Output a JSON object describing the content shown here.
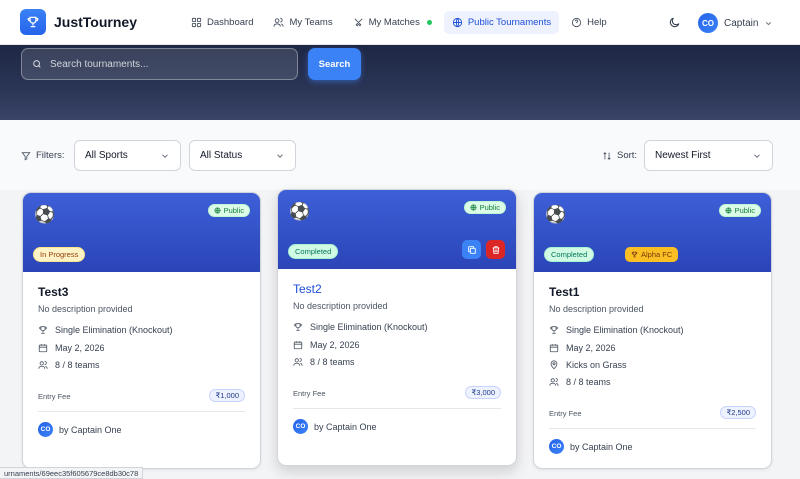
{
  "app": {
    "brand": "JustTourney"
  },
  "nav": {
    "items": [
      {
        "label": "Dashboard",
        "icon": "grid-icon"
      },
      {
        "label": "My Teams",
        "icon": "users-icon"
      },
      {
        "label": "My Matches",
        "icon": "swords-icon"
      },
      {
        "label": "Public Tournaments",
        "icon": "globe-icon"
      },
      {
        "label": "Help",
        "icon": "help-circle-icon"
      }
    ],
    "active": "Public Tournaments"
  },
  "user": {
    "initials": "CO",
    "name": "Captain"
  },
  "search": {
    "placeholder": "Search tournaments...",
    "value": "",
    "button_label": "Search"
  },
  "filters": {
    "label": "Filters:",
    "sport": "All Sports",
    "status": "All Status",
    "sort_label": "Sort:",
    "sort": "Newest First"
  },
  "cards": [
    {
      "title": "Test3",
      "visibility": "Public",
      "status": "In Progress",
      "description": "No description provided",
      "format": "Single Elimination (Knockout)",
      "date": "May 2, 2026",
      "teams": "8 / 8 teams",
      "fee_label": "Entry Fee",
      "fee": "₹1,000",
      "creator_initials": "CO",
      "creator": "by Captain One"
    },
    {
      "title": "Test2",
      "visibility": "Public",
      "status": "Completed",
      "description": "No description provided",
      "format": "Single Elimination (Knockout)",
      "date": "May 2, 2026",
      "teams": "8 / 8 teams",
      "fee_label": "Entry Fee",
      "fee": "₹3,000",
      "creator_initials": "CO",
      "creator": "by Captain One"
    },
    {
      "title": "Test1",
      "visibility": "Public",
      "status": "Completed",
      "winner": "Alpha FC",
      "description": "No description provided",
      "format": "Single Elimination (Knockout)",
      "date": "May 2, 2026",
      "venue": "Kicks on Grass",
      "teams": "8 / 8 teams",
      "fee_label": "Entry Fee",
      "fee": "₹2,500",
      "creator_initials": "CO",
      "creator": "by Captain One"
    }
  ],
  "status_url": "urnaments/69eec35f605679ce8db30c78"
}
